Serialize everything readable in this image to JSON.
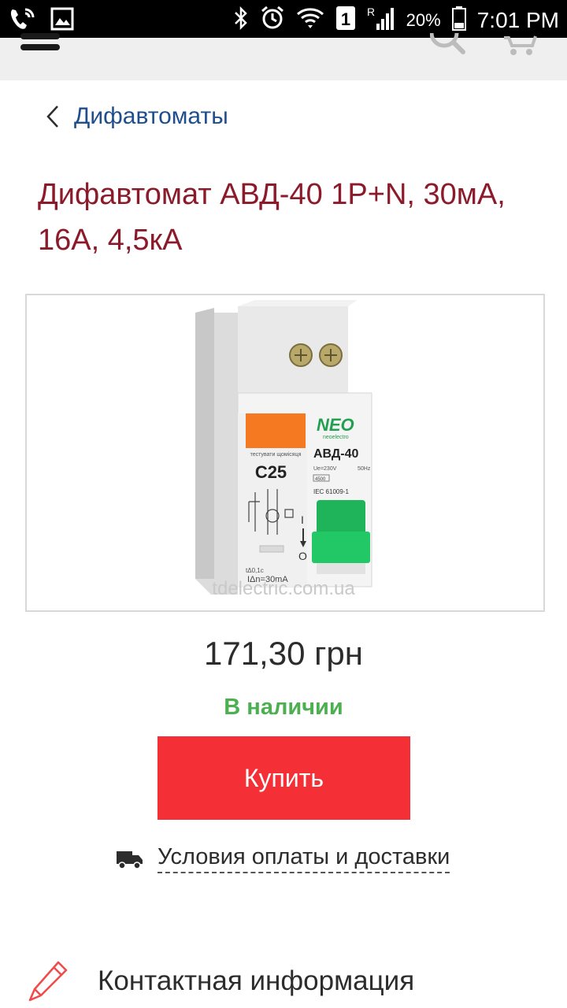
{
  "status_bar": {
    "time": "7:01 PM",
    "battery": "20%",
    "sim": "1",
    "roaming": "R",
    "icons": [
      "wifi-call-icon",
      "image-icon",
      "bluetooth-icon",
      "alarm-icon",
      "wifi-icon",
      "sim-icon",
      "signal-icon",
      "battery-icon"
    ]
  },
  "topbar": {
    "icons": [
      "menu-icon",
      "search-icon",
      "cart-icon"
    ]
  },
  "breadcrumb": {
    "label": "Дифавтоматы"
  },
  "product": {
    "title": "Дифавтомат АВД-40 1P+N, 30мА, 16А, 4,5кА",
    "image": {
      "brand": "NEO",
      "brand_sub": "neoelectro",
      "model": "АВД-40",
      "rating": "C25",
      "test_label": "тестувати щомісяця",
      "spec_voltage": "Ue=230V",
      "spec_freq": "50Hz",
      "spec_breaking": "4500",
      "spec_standard": "IEC 61009-1",
      "spec_current": "IΔn=30mA",
      "spec_time": "tΔ0,1c",
      "switch_on": "I",
      "switch_off": "O",
      "watermark": "tdelectric.com.ua"
    },
    "price": "171,30 грн",
    "stock": "В наличии",
    "buy_label": "Купить",
    "delivery_label": "Условия оплаты и доставки"
  },
  "contact": {
    "label": "Контактная информация"
  },
  "colors": {
    "title": "#8b1a2b",
    "breadcrumb": "#1f4e8c",
    "stock": "#4caf50",
    "buy_button": "#f43036",
    "switch_green": "#1fb45a",
    "test_orange": "#f47920"
  }
}
